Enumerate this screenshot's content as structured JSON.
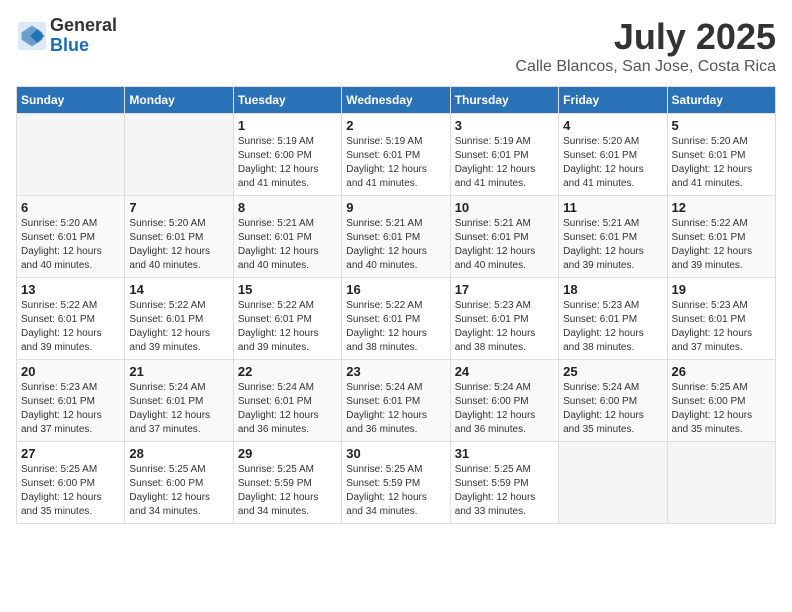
{
  "header": {
    "logo_general": "General",
    "logo_blue": "Blue",
    "month_year": "July 2025",
    "location": "Calle Blancos, San Jose, Costa Rica"
  },
  "calendar": {
    "days_of_week": [
      "Sunday",
      "Monday",
      "Tuesday",
      "Wednesday",
      "Thursday",
      "Friday",
      "Saturday"
    ],
    "weeks": [
      [
        {
          "day": "",
          "info": ""
        },
        {
          "day": "",
          "info": ""
        },
        {
          "day": "1",
          "info": "Sunrise: 5:19 AM\nSunset: 6:00 PM\nDaylight: 12 hours and 41 minutes."
        },
        {
          "day": "2",
          "info": "Sunrise: 5:19 AM\nSunset: 6:01 PM\nDaylight: 12 hours and 41 minutes."
        },
        {
          "day": "3",
          "info": "Sunrise: 5:19 AM\nSunset: 6:01 PM\nDaylight: 12 hours and 41 minutes."
        },
        {
          "day": "4",
          "info": "Sunrise: 5:20 AM\nSunset: 6:01 PM\nDaylight: 12 hours and 41 minutes."
        },
        {
          "day": "5",
          "info": "Sunrise: 5:20 AM\nSunset: 6:01 PM\nDaylight: 12 hours and 41 minutes."
        }
      ],
      [
        {
          "day": "6",
          "info": "Sunrise: 5:20 AM\nSunset: 6:01 PM\nDaylight: 12 hours and 40 minutes."
        },
        {
          "day": "7",
          "info": "Sunrise: 5:20 AM\nSunset: 6:01 PM\nDaylight: 12 hours and 40 minutes."
        },
        {
          "day": "8",
          "info": "Sunrise: 5:21 AM\nSunset: 6:01 PM\nDaylight: 12 hours and 40 minutes."
        },
        {
          "day": "9",
          "info": "Sunrise: 5:21 AM\nSunset: 6:01 PM\nDaylight: 12 hours and 40 minutes."
        },
        {
          "day": "10",
          "info": "Sunrise: 5:21 AM\nSunset: 6:01 PM\nDaylight: 12 hours and 40 minutes."
        },
        {
          "day": "11",
          "info": "Sunrise: 5:21 AM\nSunset: 6:01 PM\nDaylight: 12 hours and 39 minutes."
        },
        {
          "day": "12",
          "info": "Sunrise: 5:22 AM\nSunset: 6:01 PM\nDaylight: 12 hours and 39 minutes."
        }
      ],
      [
        {
          "day": "13",
          "info": "Sunrise: 5:22 AM\nSunset: 6:01 PM\nDaylight: 12 hours and 39 minutes."
        },
        {
          "day": "14",
          "info": "Sunrise: 5:22 AM\nSunset: 6:01 PM\nDaylight: 12 hours and 39 minutes."
        },
        {
          "day": "15",
          "info": "Sunrise: 5:22 AM\nSunset: 6:01 PM\nDaylight: 12 hours and 39 minutes."
        },
        {
          "day": "16",
          "info": "Sunrise: 5:22 AM\nSunset: 6:01 PM\nDaylight: 12 hours and 38 minutes."
        },
        {
          "day": "17",
          "info": "Sunrise: 5:23 AM\nSunset: 6:01 PM\nDaylight: 12 hours and 38 minutes."
        },
        {
          "day": "18",
          "info": "Sunrise: 5:23 AM\nSunset: 6:01 PM\nDaylight: 12 hours and 38 minutes."
        },
        {
          "day": "19",
          "info": "Sunrise: 5:23 AM\nSunset: 6:01 PM\nDaylight: 12 hours and 37 minutes."
        }
      ],
      [
        {
          "day": "20",
          "info": "Sunrise: 5:23 AM\nSunset: 6:01 PM\nDaylight: 12 hours and 37 minutes."
        },
        {
          "day": "21",
          "info": "Sunrise: 5:24 AM\nSunset: 6:01 PM\nDaylight: 12 hours and 37 minutes."
        },
        {
          "day": "22",
          "info": "Sunrise: 5:24 AM\nSunset: 6:01 PM\nDaylight: 12 hours and 36 minutes."
        },
        {
          "day": "23",
          "info": "Sunrise: 5:24 AM\nSunset: 6:01 PM\nDaylight: 12 hours and 36 minutes."
        },
        {
          "day": "24",
          "info": "Sunrise: 5:24 AM\nSunset: 6:00 PM\nDaylight: 12 hours and 36 minutes."
        },
        {
          "day": "25",
          "info": "Sunrise: 5:24 AM\nSunset: 6:00 PM\nDaylight: 12 hours and 35 minutes."
        },
        {
          "day": "26",
          "info": "Sunrise: 5:25 AM\nSunset: 6:00 PM\nDaylight: 12 hours and 35 minutes."
        }
      ],
      [
        {
          "day": "27",
          "info": "Sunrise: 5:25 AM\nSunset: 6:00 PM\nDaylight: 12 hours and 35 minutes."
        },
        {
          "day": "28",
          "info": "Sunrise: 5:25 AM\nSunset: 6:00 PM\nDaylight: 12 hours and 34 minutes."
        },
        {
          "day": "29",
          "info": "Sunrise: 5:25 AM\nSunset: 5:59 PM\nDaylight: 12 hours and 34 minutes."
        },
        {
          "day": "30",
          "info": "Sunrise: 5:25 AM\nSunset: 5:59 PM\nDaylight: 12 hours and 34 minutes."
        },
        {
          "day": "31",
          "info": "Sunrise: 5:25 AM\nSunset: 5:59 PM\nDaylight: 12 hours and 33 minutes."
        },
        {
          "day": "",
          "info": ""
        },
        {
          "day": "",
          "info": ""
        }
      ]
    ]
  }
}
